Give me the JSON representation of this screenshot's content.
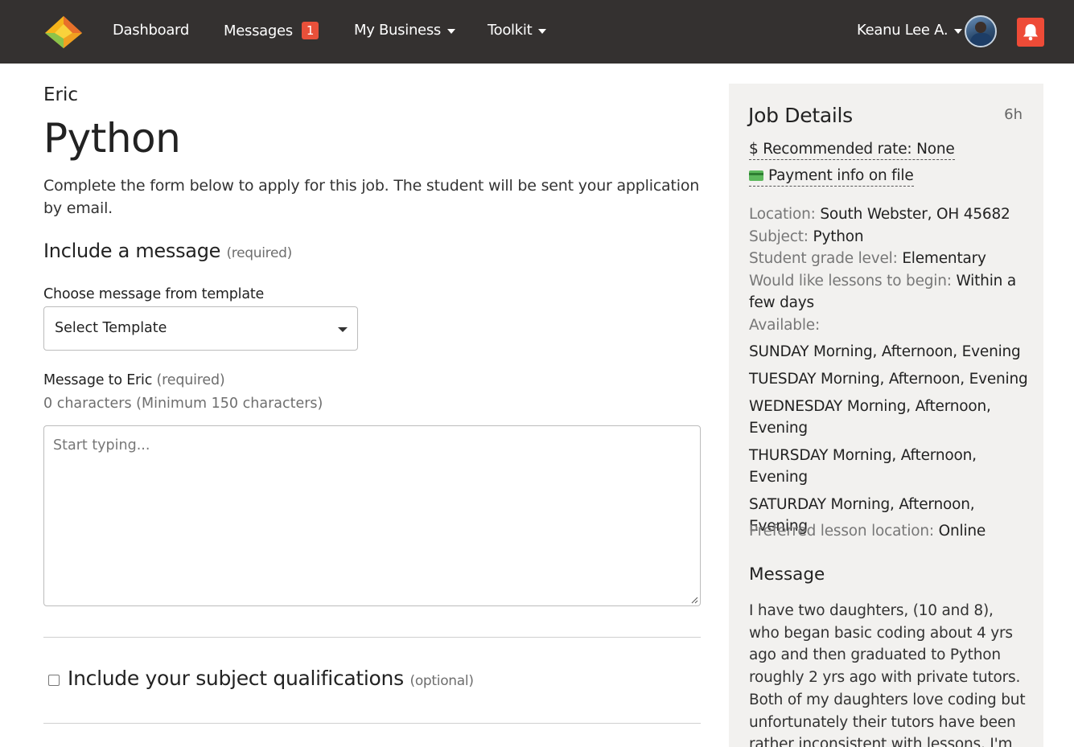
{
  "nav": {
    "items": [
      {
        "label": "Dashboard"
      },
      {
        "label": "Messages",
        "badge": "1"
      },
      {
        "label": "My Business"
      },
      {
        "label": "Toolkit"
      }
    ],
    "user_name": "Keanu Lee A."
  },
  "main": {
    "student_name": "Eric",
    "job_title": "Python",
    "intro": "Complete the form below to apply for this job. The student will be sent your application by email.",
    "message_section": {
      "title": "Include a message",
      "required": "(required)"
    },
    "template": {
      "label": "Choose message from template",
      "selected": "Select Template"
    },
    "message_field": {
      "label": "Message to Eric",
      "required": "(required)",
      "char_count": "0 characters (Minimum 150 characters)",
      "placeholder": "Start typing..."
    },
    "qualifications": {
      "label": "Include your subject qualifications",
      "optional": "(optional)"
    }
  },
  "sidebar": {
    "title": "Job Details",
    "age": "6h",
    "rate_link": "$ Recommended rate: None",
    "payment_link": "Payment info on file",
    "details": [
      {
        "key": "Location:",
        "value": "South Webster, OH 45682"
      },
      {
        "key": "Subject:",
        "value": "Python"
      },
      {
        "key": "Student grade level:",
        "value": "Elementary"
      },
      {
        "key": "Would like lessons to begin:",
        "value": "Within a few days"
      }
    ],
    "available_label": "Available:",
    "availability": [
      "SUNDAY Morning, Afternoon, Evening",
      "TUESDAY Morning, Afternoon, Evening",
      "WEDNESDAY Morning, Afternoon, Evening",
      "THURSDAY Morning, Afternoon, Evening",
      "SATURDAY Morning, Afternoon, Evening"
    ],
    "preferred": {
      "key": "Preferred lesson location:",
      "value": "Online"
    },
    "message_title": "Message",
    "message": "I have two daughters, (10 and 8), who began basic coding about 4 yrs ago and then graduated to Python roughly 2 yrs ago with private tutors. Both of my daughters love coding but unfortunately their tutors have been rather inconsistent with lessons. I'm looking for someone for"
  },
  "colors": {
    "navbar": "#343130",
    "badge": "#e8503a",
    "bell": "#ee4b37",
    "sidebar": "#f2f1ef",
    "card_icon": "#5cb85c"
  },
  "icons": {
    "logo": "diamond-logo-icon",
    "bell": "bell-icon",
    "card": "credit-card-icon"
  }
}
